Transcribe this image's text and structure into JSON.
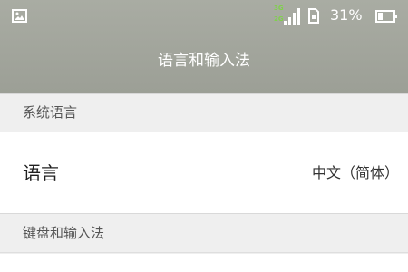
{
  "status_bar": {
    "network_top": "3G",
    "network_bottom": "2G",
    "battery_percent": "31%",
    "icons": [
      "gallery-icon",
      "signal-bars-icon",
      "sim-card-icon",
      "battery-icon"
    ],
    "colors": {
      "network": "#7fd14b",
      "text": "#ffffff"
    }
  },
  "header": {
    "title": "语言和输入法",
    "background": "#a3a69d"
  },
  "sections": [
    {
      "title": "系统语言"
    },
    {
      "title": "键盘和输入法"
    }
  ],
  "rows": [
    {
      "label": "语言",
      "value": "中文（简体）"
    }
  ]
}
